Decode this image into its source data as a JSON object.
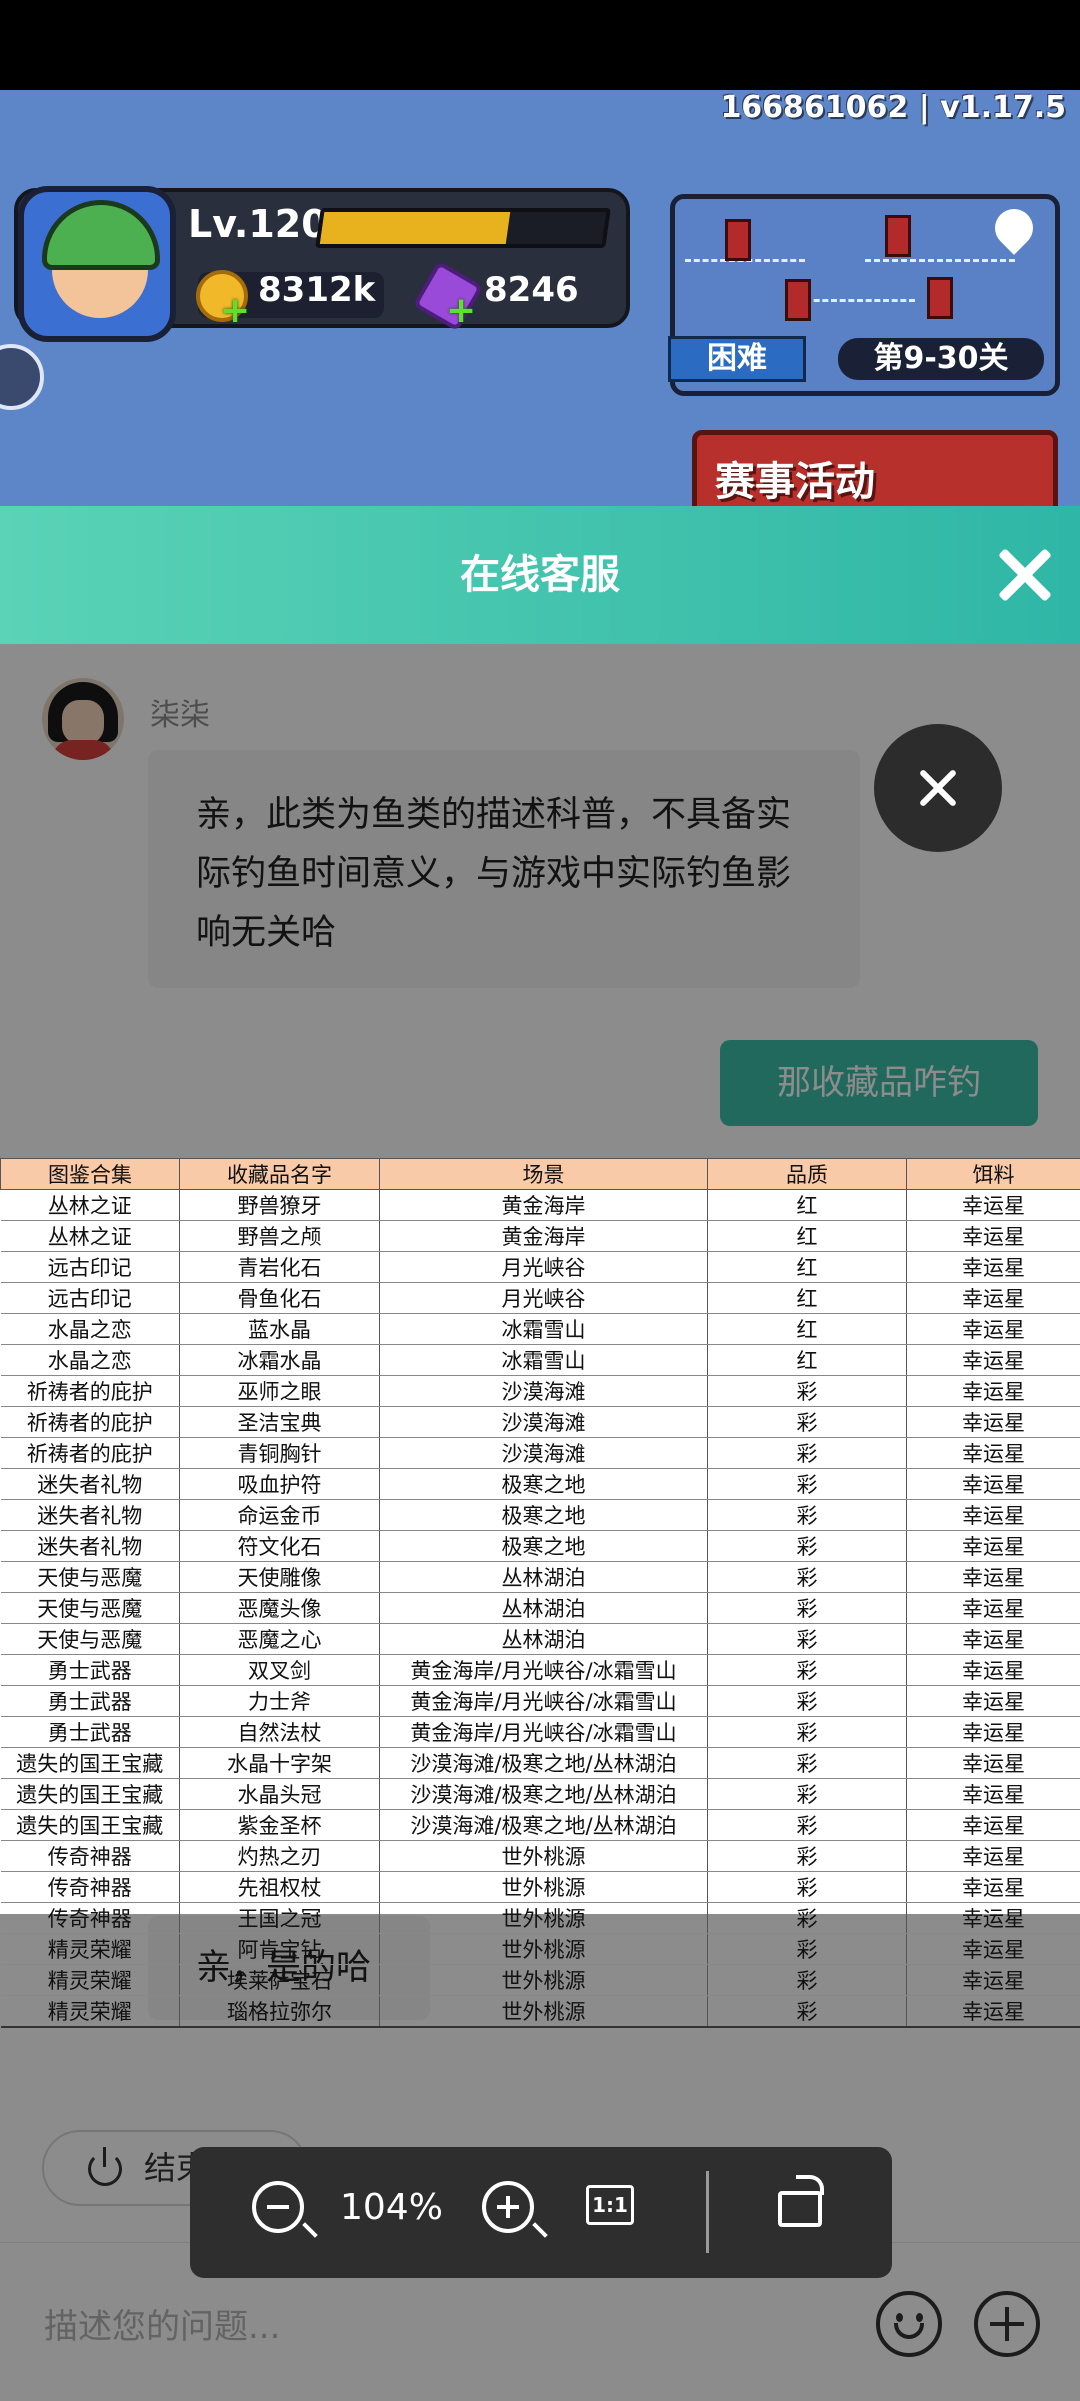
{
  "game": {
    "user_id_version": "166861062 | v1.17.5",
    "level": "Lv.120",
    "xp_fraction": 0.66,
    "coins": "8312k",
    "gems": "8246",
    "difficulty": "困难",
    "stage": "第9-30关",
    "event_label": "赛事活动"
  },
  "chat": {
    "header_title": "在线客服",
    "agent_name": "柒柒",
    "message_agent_1": "亲，此类为鱼类的描述科普，不具备实际钓鱼时间意义，与游戏中实际钓鱼影响无关哈",
    "message_user_1": "那收藏品咋钓",
    "message_agent_2": "亲，是的哈",
    "end_session_label": "结束会话",
    "input_placeholder": "描述您的问题..."
  },
  "viewer": {
    "zoom_level": "104%",
    "ratio_label": "1:1"
  },
  "sheet": {
    "headers": [
      "图鉴合集",
      "收藏品名字",
      "场景",
      "品质",
      "饵料"
    ],
    "rows": [
      [
        "丛林之证",
        "野兽獠牙",
        "黄金海岸",
        "红",
        "幸运星"
      ],
      [
        "丛林之证",
        "野兽之颅",
        "黄金海岸",
        "红",
        "幸运星"
      ],
      [
        "远古印记",
        "青岩化石",
        "月光峡谷",
        "红",
        "幸运星"
      ],
      [
        "远古印记",
        "骨鱼化石",
        "月光峡谷",
        "红",
        "幸运星"
      ],
      [
        "水晶之恋",
        "蓝水晶",
        "冰霜雪山",
        "红",
        "幸运星"
      ],
      [
        "水晶之恋",
        "冰霜水晶",
        "冰霜雪山",
        "红",
        "幸运星"
      ],
      [
        "祈祷者的庇护",
        "巫师之眼",
        "沙漠海滩",
        "彩",
        "幸运星"
      ],
      [
        "祈祷者的庇护",
        "圣洁宝典",
        "沙漠海滩",
        "彩",
        "幸运星"
      ],
      [
        "祈祷者的庇护",
        "青铜胸针",
        "沙漠海滩",
        "彩",
        "幸运星"
      ],
      [
        "迷失者礼物",
        "吸血护符",
        "极寒之地",
        "彩",
        "幸运星"
      ],
      [
        "迷失者礼物",
        "命运金币",
        "极寒之地",
        "彩",
        "幸运星"
      ],
      [
        "迷失者礼物",
        "符文化石",
        "极寒之地",
        "彩",
        "幸运星"
      ],
      [
        "天使与恶魔",
        "天使雕像",
        "丛林湖泊",
        "彩",
        "幸运星"
      ],
      [
        "天使与恶魔",
        "恶魔头像",
        "丛林湖泊",
        "彩",
        "幸运星"
      ],
      [
        "天使与恶魔",
        "恶魔之心",
        "丛林湖泊",
        "彩",
        "幸运星"
      ],
      [
        "勇士武器",
        "双叉剑",
        "黄金海岸/月光峡谷/冰霜雪山",
        "彩",
        "幸运星"
      ],
      [
        "勇士武器",
        "力士斧",
        "黄金海岸/月光峡谷/冰霜雪山",
        "彩",
        "幸运星"
      ],
      [
        "勇士武器",
        "自然法杖",
        "黄金海岸/月光峡谷/冰霜雪山",
        "彩",
        "幸运星"
      ],
      [
        "遗失的国王宝藏",
        "水晶十字架",
        "沙漠海滩/极寒之地/丛林湖泊",
        "彩",
        "幸运星"
      ],
      [
        "遗失的国王宝藏",
        "水晶头冠",
        "沙漠海滩/极寒之地/丛林湖泊",
        "彩",
        "幸运星"
      ],
      [
        "遗失的国王宝藏",
        "紫金圣杯",
        "沙漠海滩/极寒之地/丛林湖泊",
        "彩",
        "幸运星"
      ],
      [
        "传奇神器",
        "灼热之刃",
        "世外桃源",
        "彩",
        "幸运星"
      ],
      [
        "传奇神器",
        "先祖权杖",
        "世外桃源",
        "彩",
        "幸运星"
      ],
      [
        "传奇神器",
        "王国之冠",
        "世外桃源",
        "彩",
        "幸运星"
      ],
      [
        "精灵荣耀",
        "阿肯宝钻",
        "世外桃源",
        "彩",
        "幸运星"
      ],
      [
        "精灵荣耀",
        "埃莱萨宝石",
        "世外桃源",
        "彩",
        "幸运星"
      ],
      [
        "精灵荣耀",
        "瑙格拉弥尔",
        "世外桃源",
        "彩",
        "幸运星"
      ]
    ]
  }
}
